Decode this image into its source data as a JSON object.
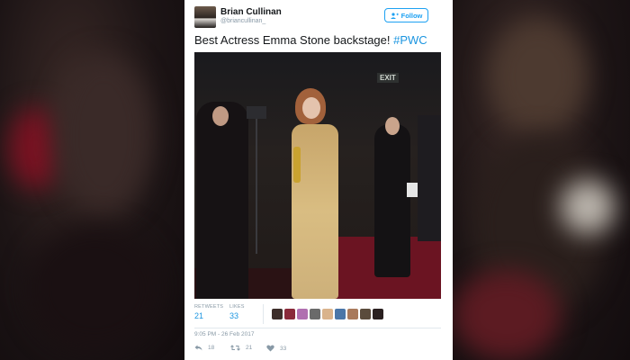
{
  "tweet": {
    "author_name": "Brian Cullinan",
    "author_handle": "@briancullinan_",
    "follow_label": "Follow",
    "text_main": "Best Actress Emma Stone backstage! ",
    "hashtag": "#PWC",
    "photo_sign": "EXIT",
    "retweets_label": "RETWEETS",
    "retweets_count": "21",
    "likes_label": "LIKES",
    "likes_count": "33",
    "timestamp": "9:05 PM - 26 Feb 2017",
    "reply_count": "18",
    "retweet_action_count": "21",
    "like_action_count": "33"
  },
  "icons": {
    "follow": "person-plus-icon",
    "reply": "reply-icon",
    "retweet": "retweet-icon",
    "like": "heart-icon"
  },
  "colors": {
    "accent": "#1da1f2",
    "link": "#1b95e0",
    "muted": "#8899a6",
    "text": "#14171a"
  }
}
